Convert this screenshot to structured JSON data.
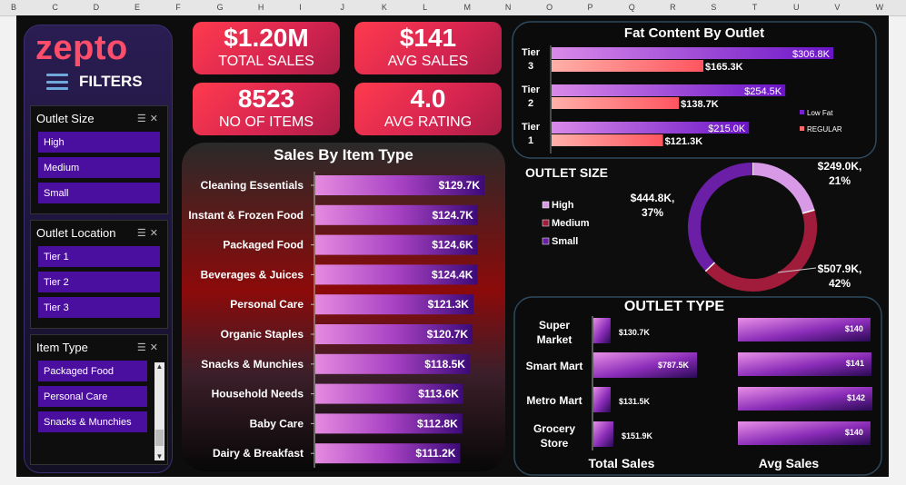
{
  "columns": [
    "B",
    "C",
    "D",
    "E",
    "F",
    "G",
    "H",
    "I",
    "J",
    "K",
    "L",
    "M",
    "N",
    "O",
    "P",
    "Q",
    "R",
    "S",
    "T",
    "U",
    "V",
    "W"
  ],
  "logo": "zepto",
  "filters_label": "FILTERS",
  "kpis": [
    {
      "value": "$1.20M",
      "label": "TOTAL SALES"
    },
    {
      "value": "$141",
      "label": "AVG SALES"
    },
    {
      "value": "8523",
      "label": "NO OF ITEMS"
    },
    {
      "value": "4.0",
      "label": "AVG RATING"
    }
  ],
  "slicers": {
    "outlet_size": {
      "title": "Outlet Size",
      "items": [
        "High",
        "Medium",
        "Small"
      ]
    },
    "outlet_location": {
      "title": "Outlet Location",
      "items": [
        "Tier 1",
        "Tier 2",
        "Tier 3"
      ]
    },
    "item_type": {
      "title": "Item Type",
      "items": [
        "Packaged Food",
        "Personal Care",
        "Snacks & Munchies"
      ]
    }
  },
  "colors": {
    "accent": "#ff4d6a",
    "slicer_item": "#4b0fa0",
    "kpi": "#e02a4e",
    "low_fat": "#7b1fd6",
    "regular": "#ff6b6b"
  },
  "chart_data": [
    {
      "type": "bar",
      "orientation": "horizontal",
      "title": "Sales By Item Type",
      "categories": [
        "Cleaning Essentials",
        "Instant & Frozen Food",
        "Packaged Food",
        "Beverages & Juices",
        "Personal Care",
        "Organic Staples",
        "Snacks & Munchies",
        "Household Needs",
        "Baby Care",
        "Dairy & Breakfast"
      ],
      "values": [
        129.7,
        124.7,
        124.6,
        124.4,
        121.3,
        120.7,
        118.5,
        113.6,
        112.8,
        111.2
      ],
      "labels": [
        "$129.7K",
        "$124.7K",
        "$124.6K",
        "$124.4K",
        "$121.3K",
        "$120.7K",
        "$118.5K",
        "$113.6K",
        "$112.8K",
        "$111.2K"
      ]
    },
    {
      "type": "bar",
      "orientation": "horizontal",
      "title": "Fat Content By Outlet",
      "categories": [
        "Tier 3",
        "Tier 2",
        "Tier 1"
      ],
      "series": [
        {
          "name": "Low Fat",
          "values": [
            306.8,
            254.5,
            215.0
          ],
          "labels": [
            "$306.8K",
            "$254.5K",
            "$215.0K"
          ]
        },
        {
          "name": "REGULAR",
          "values": [
            165.3,
            138.7,
            121.3
          ],
          "labels": [
            "$165.3K",
            "$138.7K",
            "$121.3K"
          ]
        }
      ],
      "legend": "right"
    },
    {
      "type": "pie",
      "variant": "donut",
      "title": "OUTLET SIZE",
      "categories": [
        "High",
        "Medium",
        "Small"
      ],
      "values": [
        249.0,
        507.9,
        444.8
      ],
      "labels": [
        [
          "$249.0K,",
          "21%"
        ],
        [
          "$507.9K,",
          "42%"
        ],
        [
          "$444.8K,",
          "37%"
        ]
      ],
      "colors": [
        "#d89ae6",
        "#a01c3a",
        "#6a1fa6"
      ],
      "legend": "left"
    },
    {
      "type": "bar",
      "orientation": "horizontal",
      "title": "OUTLET TYPE",
      "categories": [
        [
          "Super",
          "Market"
        ],
        [
          "Smart Mart"
        ],
        [
          "Metro Mart"
        ],
        [
          "Grocery",
          "Store"
        ]
      ],
      "series": [
        {
          "name": "Total Sales",
          "values": [
            130.7,
            787.5,
            131.5,
            151.9
          ],
          "labels": [
            "$130.7K",
            "$787.5K",
            "$131.5K",
            "$151.9K"
          ]
        },
        {
          "name": "Avg Sales",
          "values": [
            140,
            141,
            142,
            140
          ],
          "labels": [
            "$140",
            "$141",
            "$142",
            "$140"
          ]
        }
      ]
    }
  ]
}
